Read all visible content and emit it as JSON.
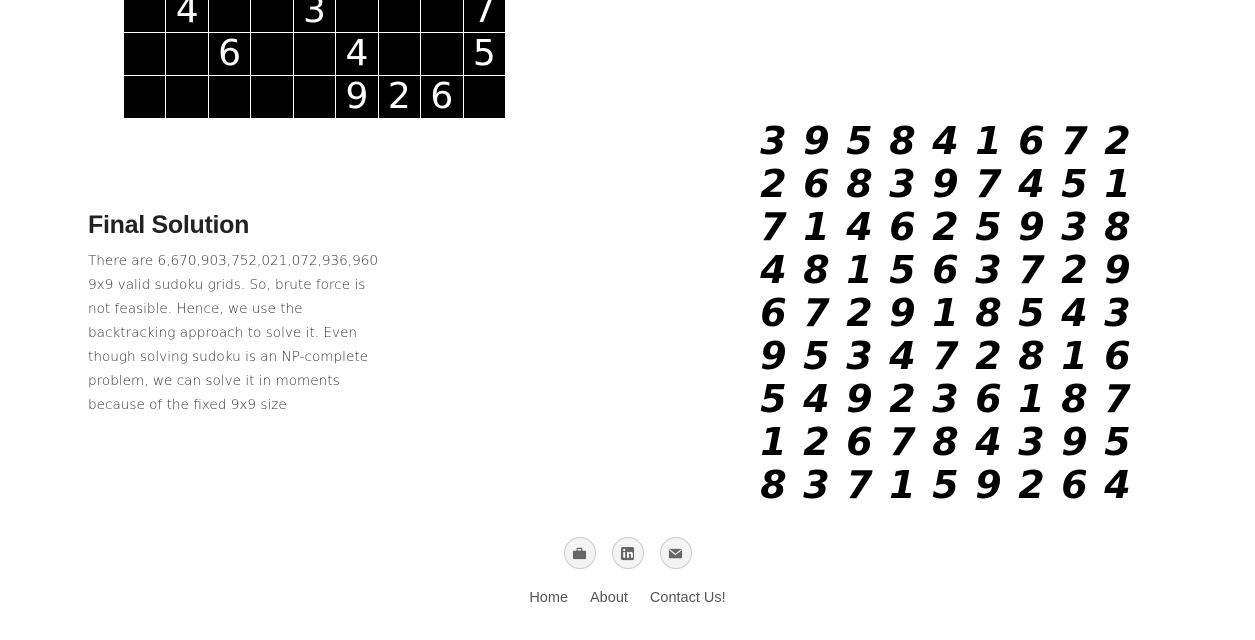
{
  "threshold_image": {
    "rows": [
      [
        "",
        "4",
        "",
        "",
        "3",
        "",
        "",
        "",
        "7"
      ],
      [
        "",
        "",
        "6",
        "",
        "",
        "4",
        "",
        "",
        "5"
      ],
      [
        "",
        "",
        "",
        "",
        "",
        "9",
        "2",
        "6",
        ""
      ]
    ]
  },
  "section": {
    "title": "Final Solution",
    "body": "There are 6,670,903,752,021,072,936,960 9x9 valid sudoku grids. So, brute force is not feasible. Hence, we use the backtracking approach to solve it. Even though solving sudoku is an NP-complete problem, we can solve it in moments because of the fixed 9x9 size"
  },
  "solution": {
    "rows": [
      [
        "3",
        "9",
        "5",
        "8",
        "4",
        "1",
        "6",
        "7",
        "2"
      ],
      [
        "2",
        "6",
        "8",
        "3",
        "9",
        "7",
        "4",
        "5",
        "1"
      ],
      [
        "7",
        "1",
        "4",
        "6",
        "2",
        "5",
        "9",
        "3",
        "8"
      ],
      [
        "4",
        "8",
        "1",
        "5",
        "6",
        "3",
        "7",
        "2",
        "9"
      ],
      [
        "6",
        "7",
        "2",
        "9",
        "1",
        "8",
        "5",
        "4",
        "3"
      ],
      [
        "9",
        "5",
        "3",
        "4",
        "7",
        "2",
        "8",
        "1",
        "6"
      ],
      [
        "5",
        "4",
        "9",
        "2",
        "3",
        "6",
        "1",
        "8",
        "7"
      ],
      [
        "1",
        "2",
        "6",
        "7",
        "8",
        "4",
        "3",
        "9",
        "5"
      ],
      [
        "8",
        "3",
        "7",
        "1",
        "5",
        "9",
        "2",
        "6",
        "4"
      ]
    ]
  },
  "footer": {
    "icons": [
      {
        "name": "briefcase-icon"
      },
      {
        "name": "linkedin-icon"
      },
      {
        "name": "email-icon"
      }
    ],
    "nav": [
      {
        "label": "Home"
      },
      {
        "label": "About"
      },
      {
        "label": "Contact Us!"
      }
    ]
  }
}
